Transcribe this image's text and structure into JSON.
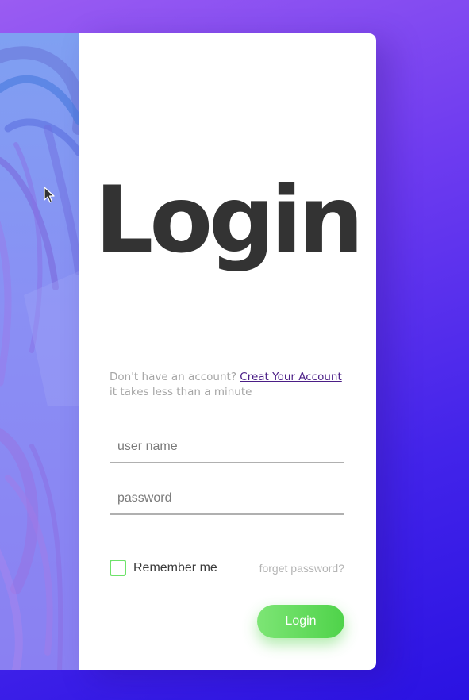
{
  "page": {
    "title": "Login"
  },
  "signup": {
    "prefix": "Don't have an account?",
    "link_text": "Creat Your Account",
    "suffix": "it takes less than a minute"
  },
  "form": {
    "username_placeholder": "user name",
    "username_value": "",
    "password_placeholder": "password",
    "password_value": ""
  },
  "remember": {
    "label": "Remember me",
    "checked": false
  },
  "forgot_label": "forget password?",
  "login_button_label": "Login",
  "colors": {
    "accent_green": "#5fdc58",
    "background_start": "#9a5cf2",
    "background_end": "#2a12e2",
    "title_text": "#333333",
    "link": "#4b1e86"
  },
  "icons": {
    "cursor": "mouse-pointer-icon",
    "checkbox": "checkbox-icon"
  }
}
